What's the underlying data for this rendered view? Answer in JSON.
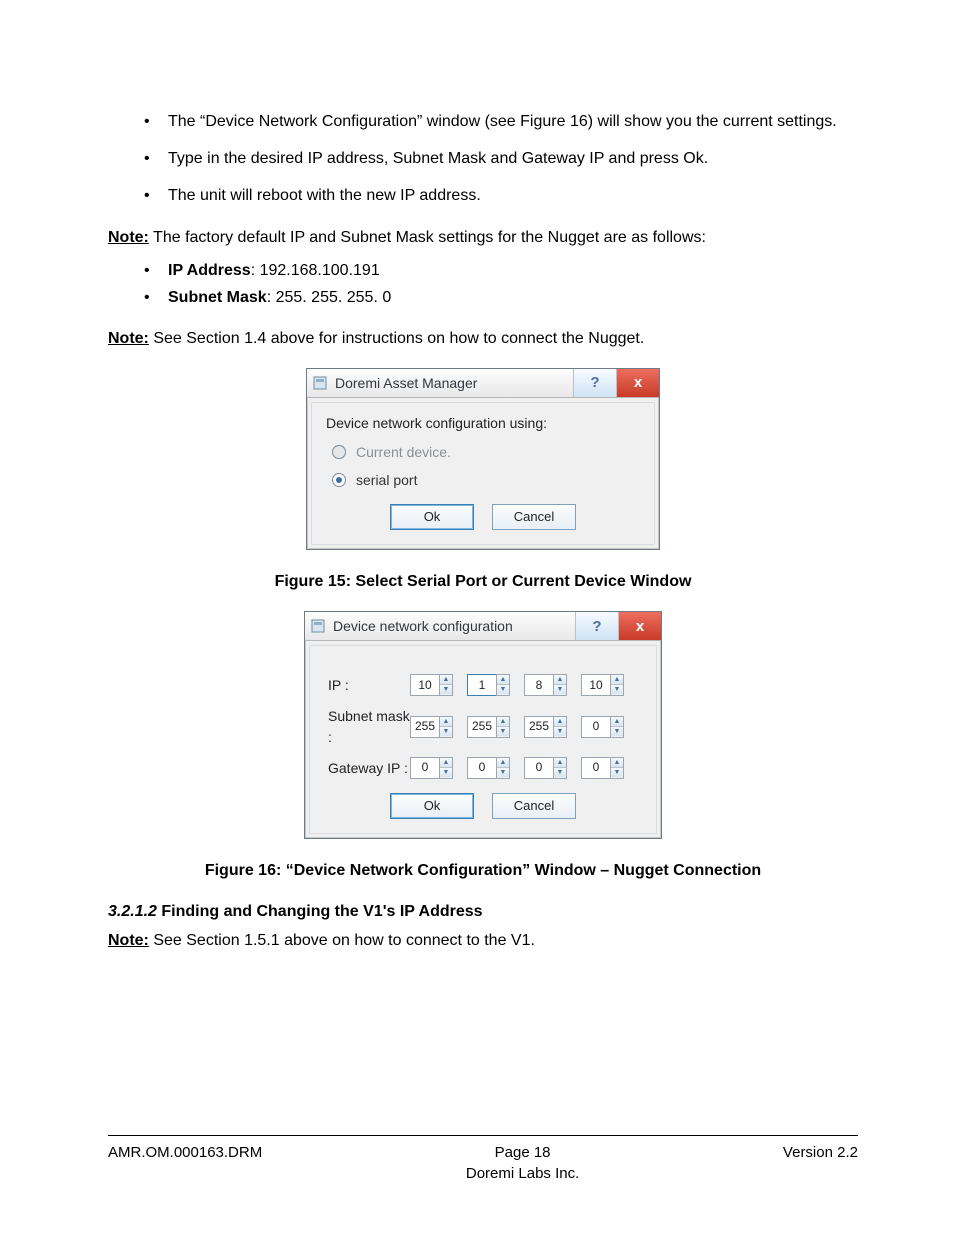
{
  "bullets": [
    "The “Device Network Configuration” window (see Figure 16) will show you the current settings.",
    "Type in the desired IP address, Subnet Mask and Gateway IP and press Ok.",
    "The unit will reboot with the new IP address."
  ],
  "note1_label": "Note:",
  "note1_text": "  The factory default IP and Subnet Mask settings for the Nugget are as follows:",
  "defaults": {
    "ip_label": "IP Address",
    "ip_value": ": 192.168.100.191",
    "mask_label": "Subnet Mask",
    "mask_value": ": 255. 255. 255. 0"
  },
  "note2_label": "Note:",
  "note2_text": " See Section  1.4  above for instructions on how to connect the Nugget.",
  "dialog1": {
    "title": "Doremi Asset Manager",
    "group": "Device network configuration using:",
    "opt1": "Current device.",
    "opt2": "serial port",
    "ok": "Ok",
    "cancel": "Cancel"
  },
  "fig15": "Figure 15:  Select Serial Port or Current Device Window",
  "dialog2": {
    "title": "Device network configuration",
    "row_ip": "IP :",
    "row_mask": "Subnet mask :",
    "row_gw": "Gateway IP :",
    "ip": [
      "10",
      "1",
      "8",
      "10"
    ],
    "mask": [
      "255",
      "255",
      "255",
      "0"
    ],
    "gw": [
      "0",
      "0",
      "0",
      "0"
    ],
    "ok": "Ok",
    "cancel": "Cancel"
  },
  "fig16": "Figure 16: “Device Network Configuration” Window – Nugget Connection",
  "section_num": " 3.2.1.2 ",
  "section_title": "  Finding and Changing the V1's IP Address",
  "note3_label": "Note:",
  "note3_text": " See Section  1.5.1  above on how to connect to the V1.",
  "footer": {
    "left": "AMR.OM.000163.DRM",
    "page": "Page 18",
    "company": "Doremi Labs Inc.",
    "right": "Version 2.2"
  }
}
